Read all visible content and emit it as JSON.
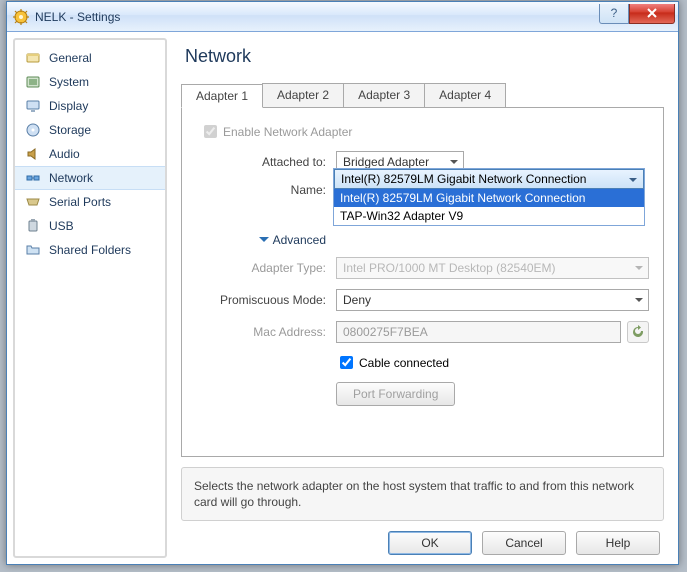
{
  "window": {
    "title": "NELK - Settings"
  },
  "sidebar": {
    "items": [
      {
        "label": "General"
      },
      {
        "label": "System"
      },
      {
        "label": "Display"
      },
      {
        "label": "Storage"
      },
      {
        "label": "Audio"
      },
      {
        "label": "Network"
      },
      {
        "label": "Serial Ports"
      },
      {
        "label": "USB"
      },
      {
        "label": "Shared Folders"
      }
    ]
  },
  "main": {
    "title": "Network",
    "tabs": [
      {
        "label": "Adapter 1"
      },
      {
        "label": "Adapter 2"
      },
      {
        "label": "Adapter 3"
      },
      {
        "label": "Adapter 4"
      }
    ],
    "enable_label": "Enable Network Adapter",
    "attached_label": "Attached to:",
    "attached_value": "Bridged Adapter",
    "name_label": "Name:",
    "name_selected": "Intel(R) 82579LM Gigabit Network Connection",
    "name_options": [
      "Intel(R) 82579LM Gigabit Network Connection",
      "TAP-Win32 Adapter V9"
    ],
    "advanced_label": "Advanced",
    "adapter_type_label": "Adapter Type:",
    "adapter_type_value": "Intel PRO/1000 MT Desktop (82540EM)",
    "promiscuous_label": "Promiscuous Mode:",
    "promiscuous_value": "Deny",
    "mac_label": "Mac Address:",
    "mac_value": "0800275F7BEA",
    "cable_label": "Cable connected",
    "port_fw_label": "Port Forwarding",
    "help_text": "Selects the network adapter on the host system that traffic to and from this network card will go through."
  },
  "footer": {
    "ok": "OK",
    "cancel": "Cancel",
    "help": "Help"
  }
}
